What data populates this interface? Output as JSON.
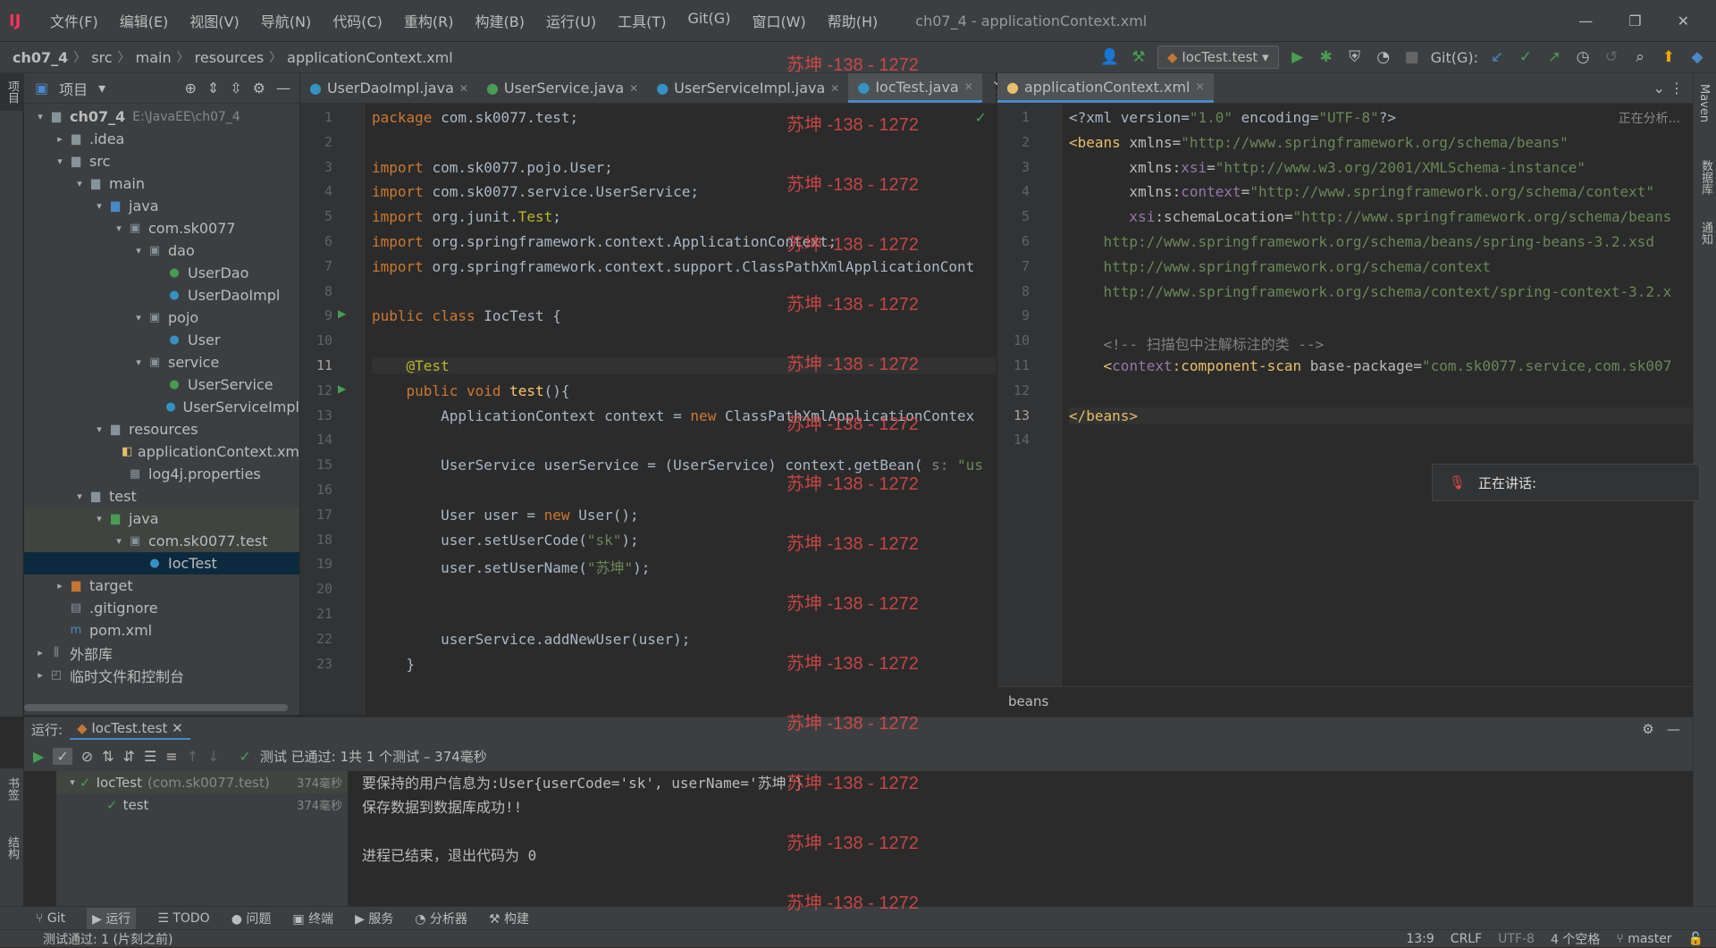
{
  "window": {
    "title": "ch07_4 - applicationContext.xml",
    "app_partial": "IntelliJ IDEA"
  },
  "menu": [
    "文件(F)",
    "编辑(E)",
    "视图(V)",
    "导航(N)",
    "代码(C)",
    "重构(R)",
    "构建(B)",
    "运行(U)",
    "工具(T)",
    "Git(G)",
    "窗口(W)",
    "帮助(H)"
  ],
  "breadcrumb": [
    "ch07_4",
    "src",
    "main",
    "resources",
    "applicationContext.xml"
  ],
  "toolbar": {
    "run_config": "IocTest.test",
    "git_label": "Git(G):"
  },
  "project_panel": {
    "title": "项目"
  },
  "tree": [
    {
      "label": "ch07_4",
      "extra": "E:\\JavaEE\\ch07_4",
      "indent": 0,
      "arrow": "▾",
      "icon": "folder"
    },
    {
      "label": ".idea",
      "indent": 1,
      "arrow": "▸",
      "icon": "folder"
    },
    {
      "label": "src",
      "indent": 1,
      "arrow": "▾",
      "icon": "folder"
    },
    {
      "label": "main",
      "indent": 2,
      "arrow": "▾",
      "icon": "folder"
    },
    {
      "label": "java",
      "indent": 3,
      "arrow": "▾",
      "icon": "folder-blue"
    },
    {
      "label": "com.sk0077",
      "indent": 4,
      "arrow": "▾",
      "icon": "package"
    },
    {
      "label": "dao",
      "indent": 5,
      "arrow": "▾",
      "icon": "package"
    },
    {
      "label": "UserDao",
      "indent": 6,
      "arrow": "",
      "icon": "interface"
    },
    {
      "label": "UserDaoImpl",
      "indent": 6,
      "arrow": "",
      "icon": "class"
    },
    {
      "label": "pojo",
      "indent": 5,
      "arrow": "▾",
      "icon": "package"
    },
    {
      "label": "User",
      "indent": 6,
      "arrow": "",
      "icon": "class"
    },
    {
      "label": "service",
      "indent": 5,
      "arrow": "▾",
      "icon": "package"
    },
    {
      "label": "UserService",
      "indent": 6,
      "arrow": "",
      "icon": "interface"
    },
    {
      "label": "UserServiceImpl",
      "indent": 6,
      "arrow": "",
      "icon": "class"
    },
    {
      "label": "resources",
      "indent": 3,
      "arrow": "▾",
      "icon": "folder"
    },
    {
      "label": "applicationContext.xm",
      "indent": 4,
      "arrow": "",
      "icon": "xml"
    },
    {
      "label": "log4j.properties",
      "indent": 4,
      "arrow": "",
      "icon": "props"
    },
    {
      "label": "test",
      "indent": 2,
      "arrow": "▾",
      "icon": "folder"
    },
    {
      "label": "java",
      "indent": 3,
      "arrow": "▾",
      "icon": "folder-green"
    },
    {
      "label": "com.sk0077.test",
      "indent": 4,
      "arrow": "▾",
      "icon": "package"
    },
    {
      "label": "IocTest",
      "indent": 5,
      "arrow": "",
      "icon": "class"
    },
    {
      "label": "target",
      "indent": 1,
      "arrow": "▸",
      "icon": "folder-orange"
    },
    {
      "label": ".gitignore",
      "indent": 1,
      "arrow": "",
      "icon": "file"
    },
    {
      "label": "pom.xml",
      "indent": 1,
      "arrow": "",
      "icon": "maven"
    },
    {
      "label": "外部库",
      "indent": 0,
      "arrow": "▸",
      "icon": "lib"
    },
    {
      "label": "临时文件和控制台",
      "indent": 0,
      "arrow": "▸",
      "icon": "scratch"
    }
  ],
  "java_tabs": [
    "UserDaoImpl.java",
    "UserService.java",
    "UserServiceImpl.java",
    "IocTest.java"
  ],
  "xml_tabs": [
    "applicationContext.xml"
  ],
  "xml_status": "正在分析...",
  "xml_breadcrumb": "beans",
  "watermark": "苏坤 -138 - 1272",
  "java_lines": [
    {
      "n": "1",
      "t": [
        [
          "kw",
          "package "
        ],
        [
          "",
          "com.sk0077.test;"
        ]
      ]
    },
    {
      "n": "2",
      "t": []
    },
    {
      "n": "3",
      "t": [
        [
          "kw",
          "import "
        ],
        [
          "",
          "com.sk0077.pojo.User;"
        ]
      ]
    },
    {
      "n": "4",
      "t": [
        [
          "kw",
          "import "
        ],
        [
          "",
          "com.sk0077.service.UserService;"
        ]
      ]
    },
    {
      "n": "5",
      "t": [
        [
          "kw",
          "import "
        ],
        [
          "",
          "org.junit."
        ],
        [
          "ann",
          "Test"
        ],
        [
          "",
          ";"
        ]
      ]
    },
    {
      "n": "6",
      "t": [
        [
          "kw",
          "import "
        ],
        [
          "",
          "org.springframework.context.ApplicationContext;"
        ]
      ]
    },
    {
      "n": "7",
      "t": [
        [
          "kw",
          "import "
        ],
        [
          "",
          "org.springframework.context.support.ClassPathXmlApplicationCont"
        ]
      ]
    },
    {
      "n": "8",
      "t": []
    },
    {
      "n": "9",
      "t": [
        [
          "kw",
          "public class "
        ],
        [
          "",
          "IocTest {"
        ]
      ]
    },
    {
      "n": "10",
      "t": []
    },
    {
      "n": "11",
      "t": [
        [
          "ann",
          "    @Test"
        ]
      ]
    },
    {
      "n": "12",
      "t": [
        [
          "kw",
          "    public void "
        ],
        [
          "fn",
          "test"
        ],
        [
          "",
          "(){"
        ]
      ]
    },
    {
      "n": "13",
      "t": [
        [
          "",
          "        ApplicationContext context = "
        ],
        [
          "kw",
          "new "
        ],
        [
          "",
          "ClassPathXmlApplicationContex"
        ]
      ]
    },
    {
      "n": "14",
      "t": []
    },
    {
      "n": "15",
      "t": [
        [
          "",
          "        UserService userService = (UserService) context.getBean( "
        ],
        [
          "cmt",
          "s: "
        ],
        [
          "str",
          "\"us"
        ]
      ]
    },
    {
      "n": "16",
      "t": []
    },
    {
      "n": "17",
      "t": [
        [
          "",
          "        User user = "
        ],
        [
          "kw",
          "new "
        ],
        [
          "",
          "User();"
        ]
      ]
    },
    {
      "n": "18",
      "t": [
        [
          "",
          "        user.setUserCode("
        ],
        [
          "str",
          "\"sk\""
        ],
        [
          "",
          ");"
        ]
      ]
    },
    {
      "n": "19",
      "t": [
        [
          "",
          "        user.setUserName("
        ],
        [
          "str",
          "\"苏坤\""
        ],
        [
          "",
          ");"
        ]
      ]
    },
    {
      "n": "20",
      "t": []
    },
    {
      "n": "21",
      "t": []
    },
    {
      "n": "22",
      "t": [
        [
          "",
          "        userService.addNewUser(user);"
        ]
      ]
    },
    {
      "n": "23",
      "t": [
        [
          "",
          "    }"
        ]
      ]
    }
  ],
  "xml_lines": [
    {
      "n": "1",
      "t": [
        [
          "",
          "<?xml version="
        ],
        [
          "str",
          "\"1.0\""
        ],
        [
          "",
          " encoding="
        ],
        [
          "str",
          "\"UTF-8\""
        ],
        [
          "",
          "?>"
        ]
      ]
    },
    {
      "n": "2",
      "t": [
        [
          "tag",
          "<beans "
        ],
        [
          "attr",
          "xmlns="
        ],
        [
          "str",
          "\"http://www.springframework.org/schema/beans\""
        ]
      ]
    },
    {
      "n": "3",
      "t": [
        [
          "attr",
          "       xmlns:"
        ],
        [
          "ns",
          "xsi"
        ],
        [
          "attr",
          "="
        ],
        [
          "str",
          "\"http://www.w3.org/2001/XMLSchema-instance\""
        ]
      ]
    },
    {
      "n": "4",
      "t": [
        [
          "attr",
          "       xmlns:"
        ],
        [
          "ns",
          "context"
        ],
        [
          "attr",
          "="
        ],
        [
          "str",
          "\"http://www.springframework.org/schema/context\""
        ]
      ]
    },
    {
      "n": "5",
      "t": [
        [
          "ns",
          "       xsi"
        ],
        [
          "attr",
          ":schemaLocation="
        ],
        [
          "str",
          "\"http://www.springframework.org/schema/beans"
        ]
      ]
    },
    {
      "n": "6",
      "t": [
        [
          "str",
          "    http://www.springframework.org/schema/beans/spring-beans-3.2.xsd"
        ]
      ]
    },
    {
      "n": "7",
      "t": [
        [
          "str",
          "    http://www.springframework.org/schema/context"
        ]
      ]
    },
    {
      "n": "8",
      "t": [
        [
          "str",
          "    http://www.springframework.org/schema/context/spring-context-3.2.x"
        ]
      ]
    },
    {
      "n": "9",
      "t": []
    },
    {
      "n": "10",
      "t": [
        [
          "cmt",
          "    <!-- 扫描包中注解标注的类 -->"
        ]
      ]
    },
    {
      "n": "11",
      "t": [
        [
          "tag",
          "    <"
        ],
        [
          "ns",
          "context"
        ],
        [
          "tag",
          ":component-scan "
        ],
        [
          "attr",
          "base-package="
        ],
        [
          "str",
          "\"com.sk0077.service,com.sk007"
        ]
      ]
    },
    {
      "n": "12",
      "t": []
    },
    {
      "n": "13",
      "t": [
        [
          "tag",
          "</beans>"
        ]
      ]
    },
    {
      "n": "14",
      "t": []
    }
  ],
  "run": {
    "label": "运行:",
    "tab": "IocTest.test",
    "summary": "测试 已通过: 1共 1 个测试 – 374毫秒",
    "tests": [
      {
        "name": "IocTest",
        "sub": "(com.sk0077.test)",
        "time": "374毫秒",
        "indent": 0
      },
      {
        "name": "test",
        "sub": "",
        "time": "374毫秒",
        "indent": 1
      }
    ],
    "console": [
      "要保持的用户信息为:User{userCode='sk', userName='苏坤'}",
      "保存数据到数据库成功!!",
      "",
      "进程已结束，退出代码为 0"
    ]
  },
  "bottom_tabs": [
    "Git",
    "运行",
    "TODO",
    "问题",
    "终端",
    "服务",
    "分析器",
    "构建"
  ],
  "status": {
    "message": "测试通过: 1 (片刻之前)",
    "position": "13:9",
    "line_sep": "CRLF",
    "encoding": "UTF-8",
    "indent": "4 个空格",
    "branch": "master"
  },
  "speaking": {
    "label": "正在讲话:"
  },
  "side_labels": {
    "left": [
      "项目",
      "书签",
      "结构"
    ],
    "right": [
      "Maven",
      "数据库",
      "通知"
    ]
  },
  "colors": {
    "accent": "#4a88c7",
    "bg": "#2b2b2b",
    "panel": "#3c3f41",
    "green": "#499c54",
    "watermark": "#e24a4a"
  }
}
